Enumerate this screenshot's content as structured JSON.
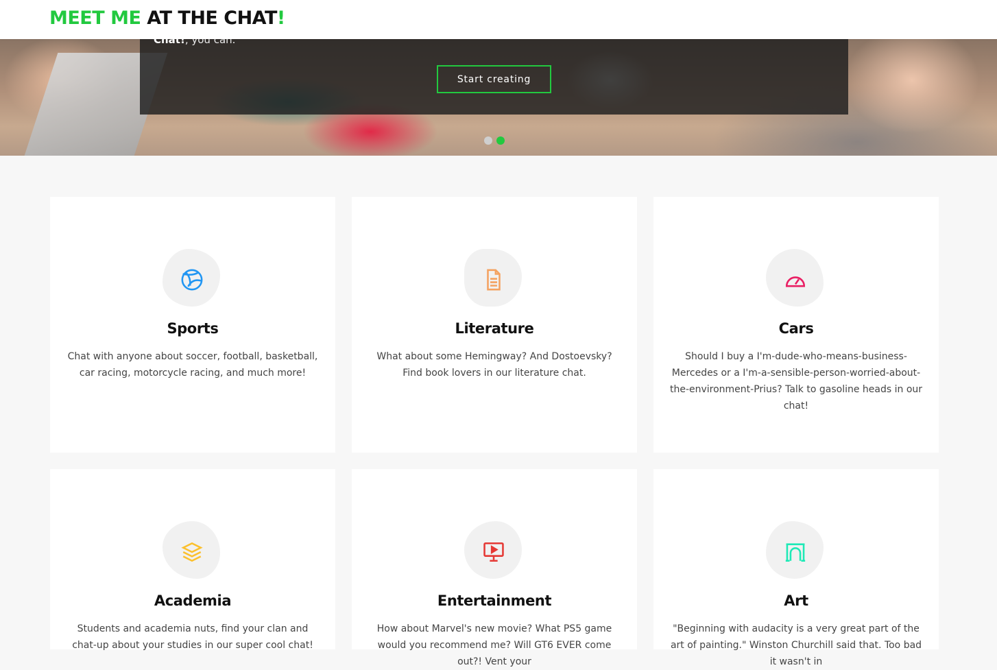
{
  "header": {
    "logo_part1": "MEET ME",
    "logo_part2": "AT THE CHAT",
    "logo_part3": "!"
  },
  "hero": {
    "text_bold": "Chat!",
    "text_rest": ", you can.",
    "cta_label": "Start creating",
    "slides": [
      {
        "active": false
      },
      {
        "active": true
      }
    ]
  },
  "cards": [
    {
      "title": "Sports",
      "description": "Chat with anyone about soccer, football, basketball, car racing, motorcycle racing, and much more!",
      "icon": "basketball-icon",
      "color": "#2196f3"
    },
    {
      "title": "Literature",
      "description": "What about some Hemingway? And Dostoevsky? Find book lovers in our literature chat.",
      "icon": "document-icon",
      "color": "#f4a261"
    },
    {
      "title": "Cars",
      "description": "Should I buy a I'm-dude-who-means-business-Mercedes or a I'm-a-sensible-person-worried-about-the-environment-Prius? Talk to gasoline heads in our chat!",
      "icon": "speedometer-icon",
      "color": "#e91e63"
    },
    {
      "title": "Academia",
      "description": "Students and academia nuts, find your clan and chat-up about your studies in our super cool chat!",
      "icon": "layers-icon",
      "color": "#fbc02d"
    },
    {
      "title": "Entertainment",
      "description": "How about Marvel's new movie? What PS5 game would you recommend me? Will GT6 EVER come out?! Vent your",
      "icon": "screen-play-icon",
      "color": "#e53935"
    },
    {
      "title": "Art",
      "description": "\"Beginning with audacity is a very great part of the art of painting.\" Winston Churchill said that. Too bad it wasn't in",
      "icon": "arch-icon",
      "color": "#1de9b6"
    }
  ]
}
